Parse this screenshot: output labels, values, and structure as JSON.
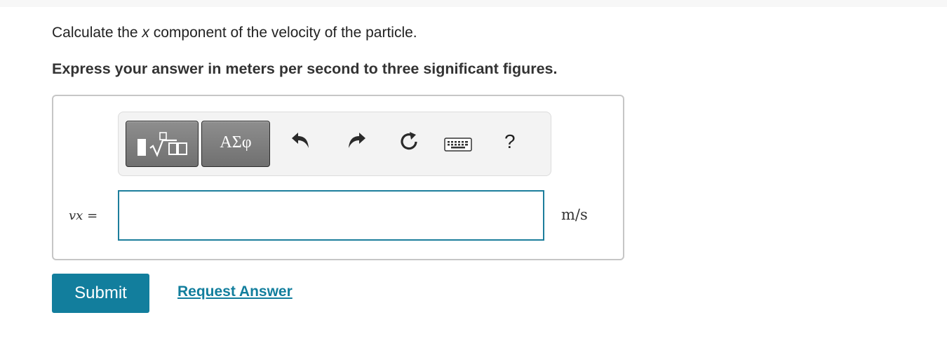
{
  "question": {
    "prefix": "Calculate the ",
    "variable": "x",
    "suffix": " component of the velocity of the particle."
  },
  "instruction": "Express your answer in meters per second to three significant figures.",
  "toolbar": {
    "templates_icon": "templates-sqrt-icon",
    "greek_label": "ΑΣφ",
    "undo_icon": "undo-icon",
    "redo_icon": "redo-icon",
    "reset_icon": "reset-icon",
    "keyboard_icon": "keyboard-icon",
    "help_label": "?"
  },
  "answer": {
    "variable_main": "v",
    "variable_sub": "x",
    "equals": "=",
    "value": "",
    "unit": "m/s"
  },
  "actions": {
    "submit_label": "Submit",
    "request_answer_label": "Request Answer"
  },
  "colors": {
    "accent": "#127e9d",
    "input_border": "#1d7e9c",
    "toolbar_button": "#7a7a7a"
  }
}
